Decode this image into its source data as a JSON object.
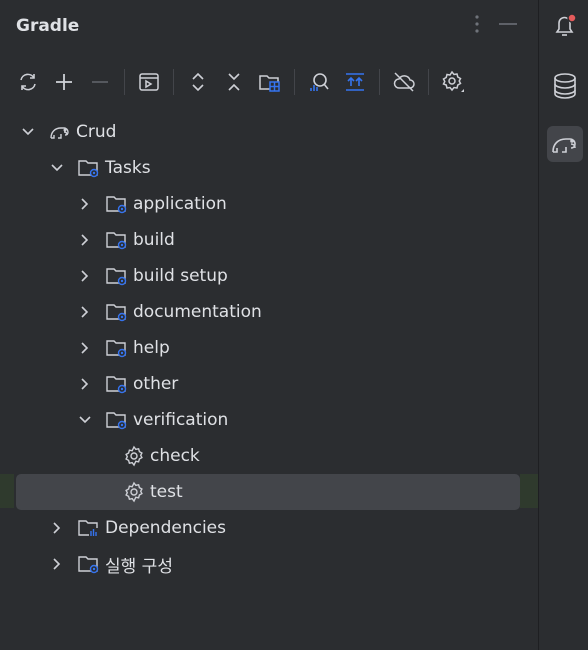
{
  "panel": {
    "title": "Gradle"
  },
  "toolbar": {
    "items": [
      "reload-icon",
      "add-icon",
      "remove-icon",
      "run-config-icon",
      "expand-all-icon",
      "collapse-all-icon",
      "folder-grid-icon",
      "analyze-icon",
      "upload-icon",
      "offline-icon",
      "settings-icon"
    ]
  },
  "tree": {
    "root": "Crud",
    "tasks": "Tasks",
    "groups": [
      "application",
      "build",
      "build setup",
      "documentation",
      "help",
      "other",
      "verification"
    ],
    "verification_tasks": [
      "check",
      "test"
    ],
    "dependencies": "Dependencies",
    "run_configs": "실행 구성"
  },
  "colors": {
    "background": "#2b2d30",
    "selection": "#43454a",
    "accent": "#3574f0",
    "notification_badge": "#e55b5b"
  }
}
